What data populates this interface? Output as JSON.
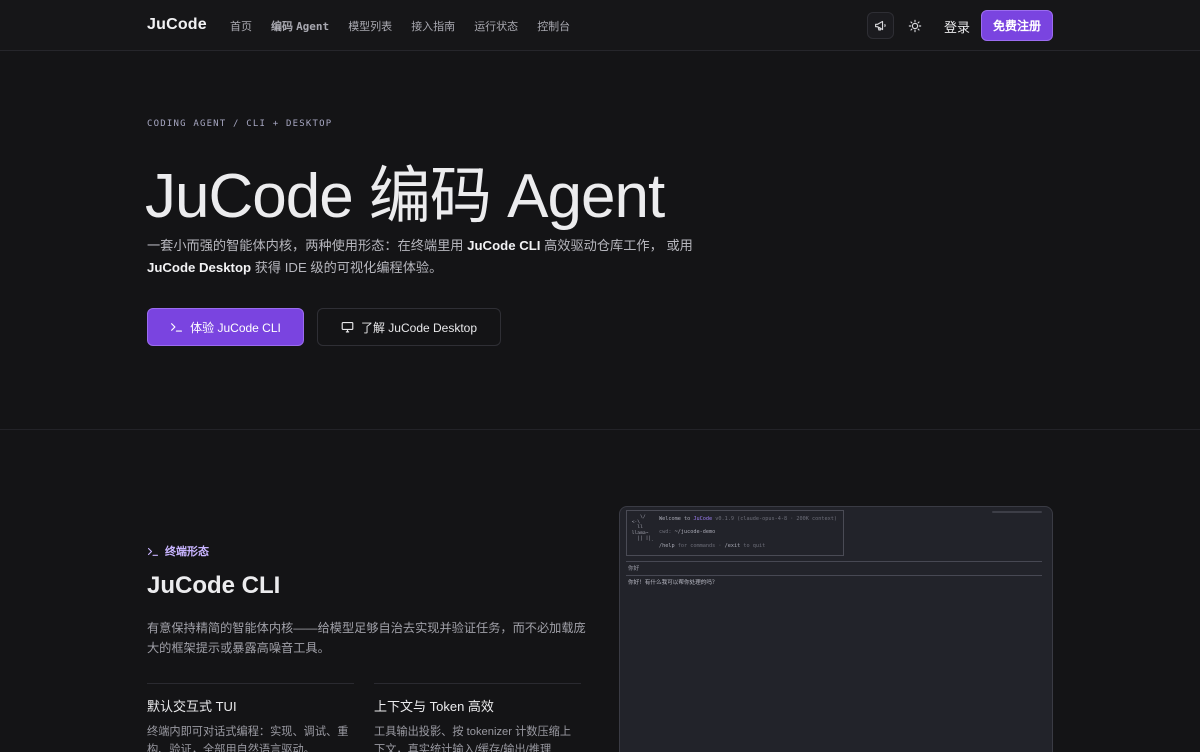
{
  "nav": {
    "brand": "JuCode",
    "links": [
      {
        "label": "首页",
        "active": false
      },
      {
        "label": "编码",
        "suffix": "Agent",
        "active": true
      },
      {
        "label": "模型列表",
        "active": false
      },
      {
        "label": "接入指南",
        "active": false
      },
      {
        "label": "运行状态",
        "active": false
      },
      {
        "label": "控制台",
        "active": false
      }
    ],
    "icons": [
      "megaphone-icon",
      "sun-icon"
    ],
    "login": "登录",
    "signup": "免费注册"
  },
  "hero": {
    "eyebrow": "CODING AGENT / CLI + DESKTOP",
    "title": "JuCode 编码 Agent",
    "desc_1": "一套小而强的智能体内核，两种使用形态：在终端里用 ",
    "desc_cli": "JuCode CLI",
    "desc_2": " 高效驱动仓库工作， 或用 ",
    "desc_desktop": "JuCode Desktop",
    "desc_3": " 获得 IDE 级的可视化编程体验。",
    "primary_button": "体验 JuCode CLI",
    "secondary_button": "了解 JuCode Desktop"
  },
  "cli": {
    "label": "终端形态",
    "title": "JuCode CLI",
    "desc": "有意保持精简的智能体内核——给模型足够自治去实现并验证任务，而不必加载庞大的框架提示或暴露高噪音工具。",
    "features": [
      {
        "title": "默认交互式 TUI",
        "desc": "终端内即可对话式编程：实现、调试、重构、验证，全部用自然语言驱动。"
      },
      {
        "title": "上下文与 Token 高效",
        "desc": "工具输出投影、按 tokenizer 计数压缩上下文，真实统计输入/缓存/输出/推理 token。"
      }
    ]
  },
  "terminal": {
    "welcome_prefix": "Welcome to ",
    "welcome_app": "JuCode",
    "welcome_version": " v0.1.9 (claude-opus-4-8 · 200K context)",
    "cwd_label": "cwd: ",
    "cwd_value": "~/jucode-demo",
    "help_cmd": "/help",
    "help_mid": " for commands · ",
    "exit_cmd": "/exit",
    "help_end": " to quit",
    "user_input": "你好",
    "reply": "你好！有什么我可以帮你处理的吗？"
  },
  "colors": {
    "accent": "#7a44e0",
    "accent_light": "#c8b4ff",
    "background": "#141416"
  }
}
